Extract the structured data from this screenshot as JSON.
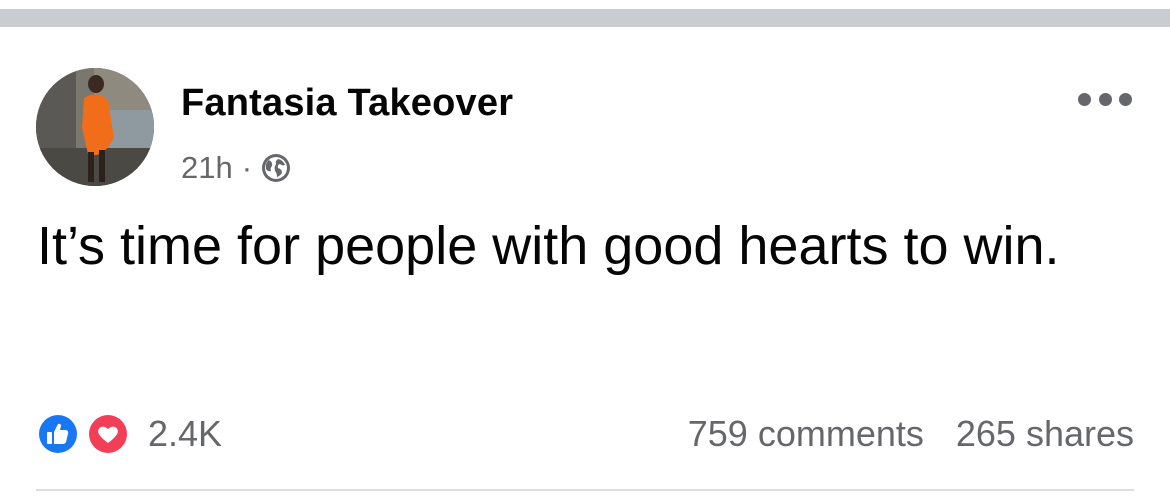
{
  "post": {
    "author": "Fantasia Takeover",
    "time": "21h",
    "separator": "·",
    "audience_icon": "globe-icon",
    "text": "It’s time for people with good hearts to win.",
    "more_icon": "more-options-icon"
  },
  "engagement": {
    "reaction_icons": [
      "like-icon",
      "love-icon"
    ],
    "reaction_count": "2.4K",
    "comments": "759 comments",
    "shares": "265 shares"
  },
  "colors": {
    "divider_gray": "#c9ccd1",
    "secondary_text": "#65676b",
    "like_blue": "#1877f2",
    "love_red": "#f33e58"
  }
}
